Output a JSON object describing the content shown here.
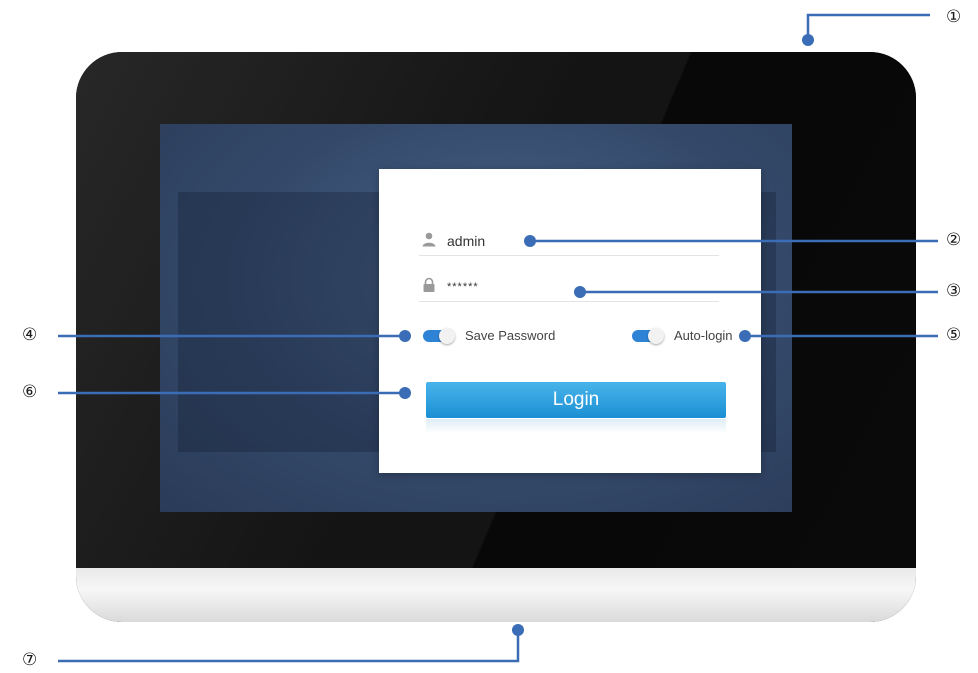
{
  "device": {
    "login_form": {
      "username": {
        "value": "admin",
        "icon": "user-icon"
      },
      "password": {
        "value": "******",
        "icon": "lock-icon"
      },
      "save_password": {
        "label": "Save Password",
        "on": true
      },
      "auto_login": {
        "label": "Auto-login",
        "on": true
      },
      "login_button": {
        "label": "Login"
      }
    }
  },
  "callouts": [
    "①",
    "②",
    "③",
    "④",
    "⑤",
    "⑥",
    "⑦"
  ],
  "colors": {
    "callout_line": "#3a6db5",
    "toggle_on": "#2e83d6",
    "button_top": "#49b4ea",
    "button_bottom": "#1b8fd4"
  }
}
